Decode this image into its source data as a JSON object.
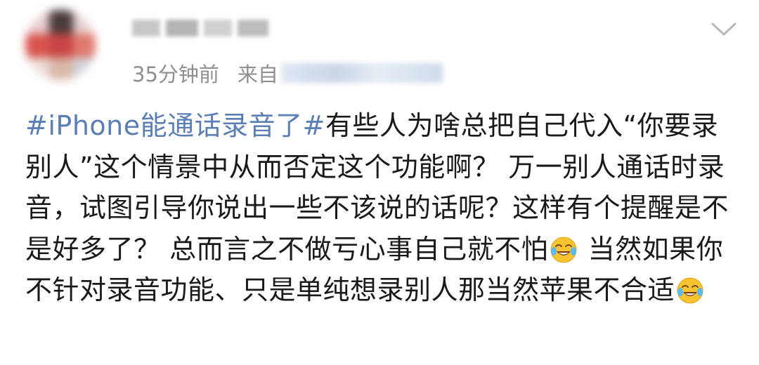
{
  "post": {
    "time": "35分钟前",
    "source_prefix": "来自",
    "hashtag": "#iPhone能通话录音了#",
    "body_part1": "有些人为啥总把自己代入“你要录别人”这个情景中从而否定这个功能啊？ 万一别人通话时录音，试图引导你说出一些不该说的话呢？这样有个提醒是不是好多了？ 总而言之不做亏心事自己就不怕",
    "body_part2": " 当然如果你不针对录音功能、只是单纯想录别人那当然苹果不合适",
    "emoji_name": "laughing-tears-emoji"
  },
  "colors": {
    "hashtag": "#5a7eb5",
    "meta_text": "#8f8f8f",
    "body_text": "#1a1a1a"
  },
  "icons": {
    "menu": "chevron-down-icon"
  }
}
